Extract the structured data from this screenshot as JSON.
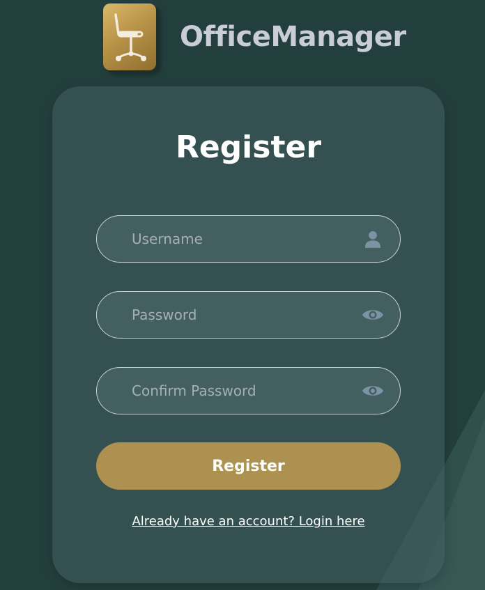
{
  "app": {
    "name": "OfficeManager",
    "logo_icon": "office-chair-icon"
  },
  "form": {
    "title": "Register",
    "username": {
      "placeholder": "Username",
      "value": "",
      "icon": "user-icon"
    },
    "password": {
      "placeholder": "Password",
      "value": "",
      "icon": "eye-icon"
    },
    "confirm_password": {
      "placeholder": "Confirm Password",
      "value": "",
      "icon": "eye-icon"
    },
    "submit_label": "Register",
    "login_link": "Already have an account? Login here"
  },
  "colors": {
    "background": "#233f3d",
    "card": "#3b5556",
    "accent": "#ad9150",
    "icon": "#7c93a3",
    "brand_text": "#c9ced6"
  }
}
